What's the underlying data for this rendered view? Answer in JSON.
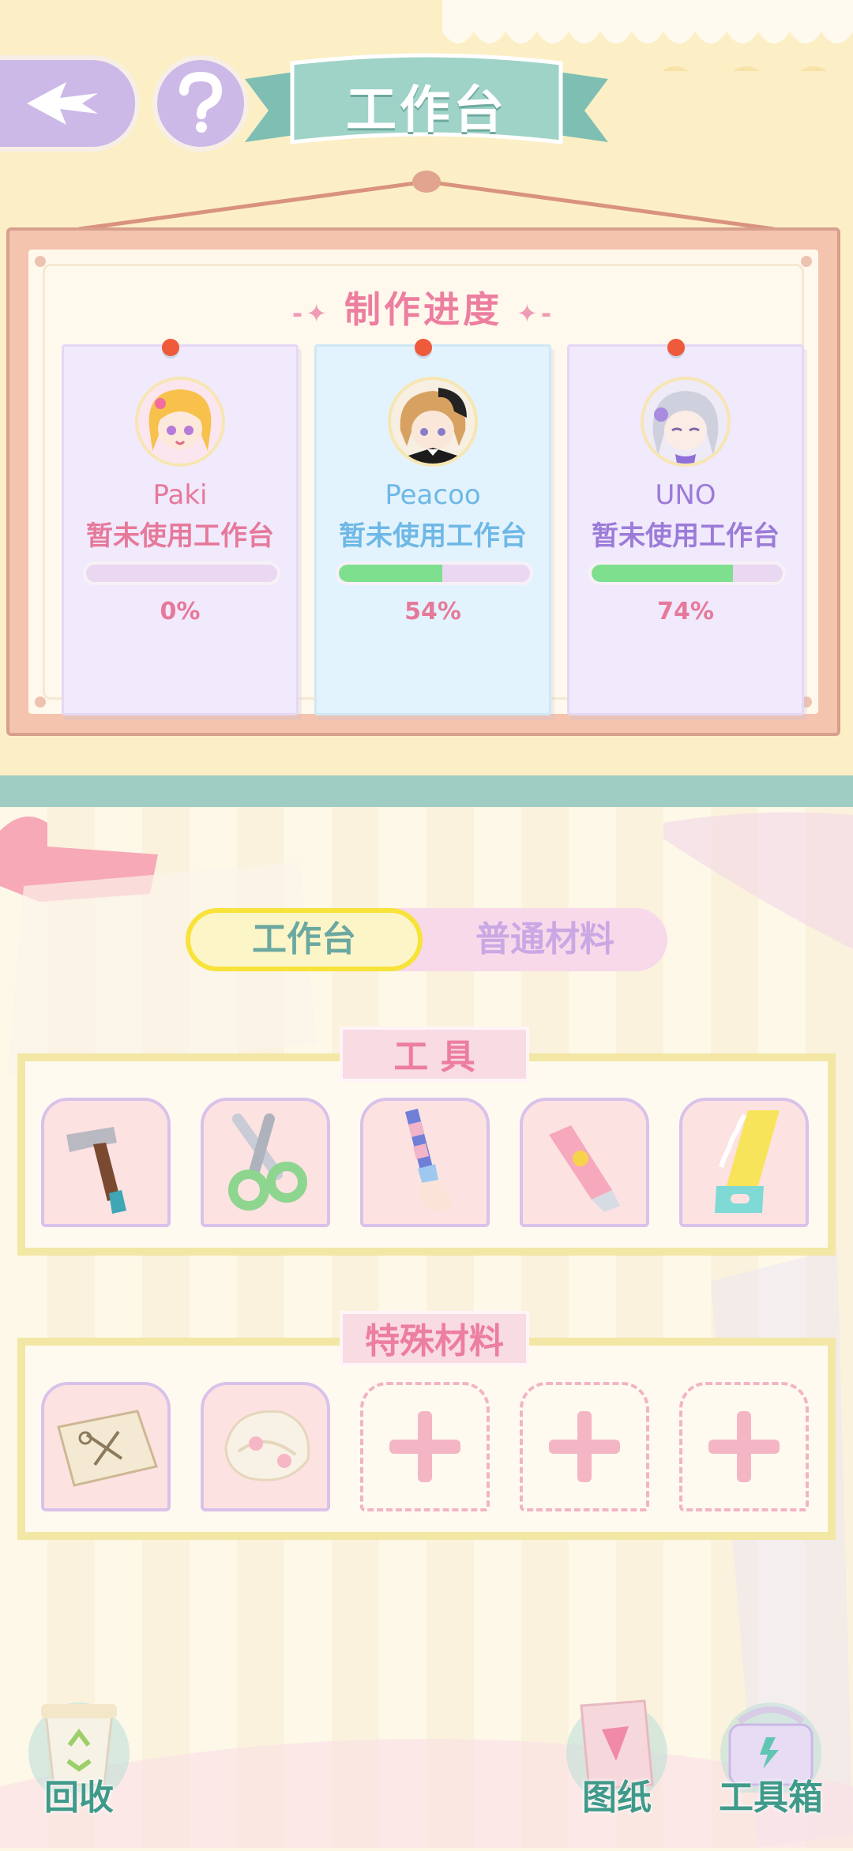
{
  "header": {
    "title": "工作台",
    "back_icon": "back-arrow-icon",
    "help_icon": "question-icon"
  },
  "progress": {
    "title": "制作进度",
    "workers": [
      {
        "name": "Paki",
        "status": "暂未使用工作台",
        "percent_label": "0%",
        "progress": 0.0,
        "name_color": "#e6799a",
        "status_color": "#e6799a"
      },
      {
        "name": "Peacoo",
        "status": "暂未使用工作台",
        "percent_label": "54%",
        "progress": 0.54,
        "name_color": "#6eb8e6",
        "status_color": "#6eb8e6"
      },
      {
        "name": "UNO",
        "status": "暂未使用工作台",
        "percent_label": "74%",
        "progress": 0.74,
        "name_color": "#9b7bd8",
        "status_color": "#9b7bd8"
      }
    ]
  },
  "tabs": {
    "active": "工作台",
    "inactive": "普通材料"
  },
  "tools": {
    "label": "工 具",
    "items": [
      "hammer-icon",
      "scissors-icon",
      "paintbrush-icon",
      "utility-knife-icon",
      "saw-icon"
    ]
  },
  "special": {
    "label": "特殊材料",
    "items": [
      "pattern-paper-icon",
      "lace-bonnet-icon"
    ],
    "empty_slots": 3
  },
  "bottom": {
    "recycle": "回收",
    "blueprint": "图纸",
    "toolbox": "工具箱"
  },
  "colors": {
    "accent_pink": "#ec7ea0",
    "teal": "#9fcdc3",
    "progress_green": "#7ee08f"
  }
}
